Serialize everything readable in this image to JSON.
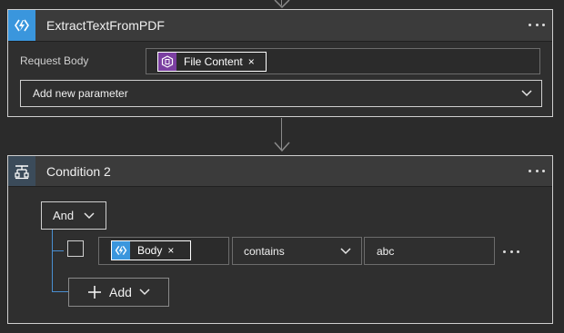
{
  "action_card": {
    "title": "ExtractTextFromPDF",
    "icon": "azure-function-icon",
    "request_body_label": "Request Body",
    "token": {
      "label": "File Content",
      "icon": "file-content-icon",
      "remove": "×"
    },
    "add_param_label": "Add new parameter"
  },
  "condition_card": {
    "title": "Condition 2",
    "icon": "condition-icon",
    "group_operator": "And",
    "row": {
      "token": {
        "label": "Body",
        "icon": "azure-function-icon",
        "remove": "×"
      },
      "operator": "contains",
      "value": "abc"
    },
    "add_label": "Add"
  },
  "colors": {
    "function_blue": "#3a96dd",
    "content_purple": "#7b3fa1",
    "condition_header": "#3b4b5a"
  }
}
